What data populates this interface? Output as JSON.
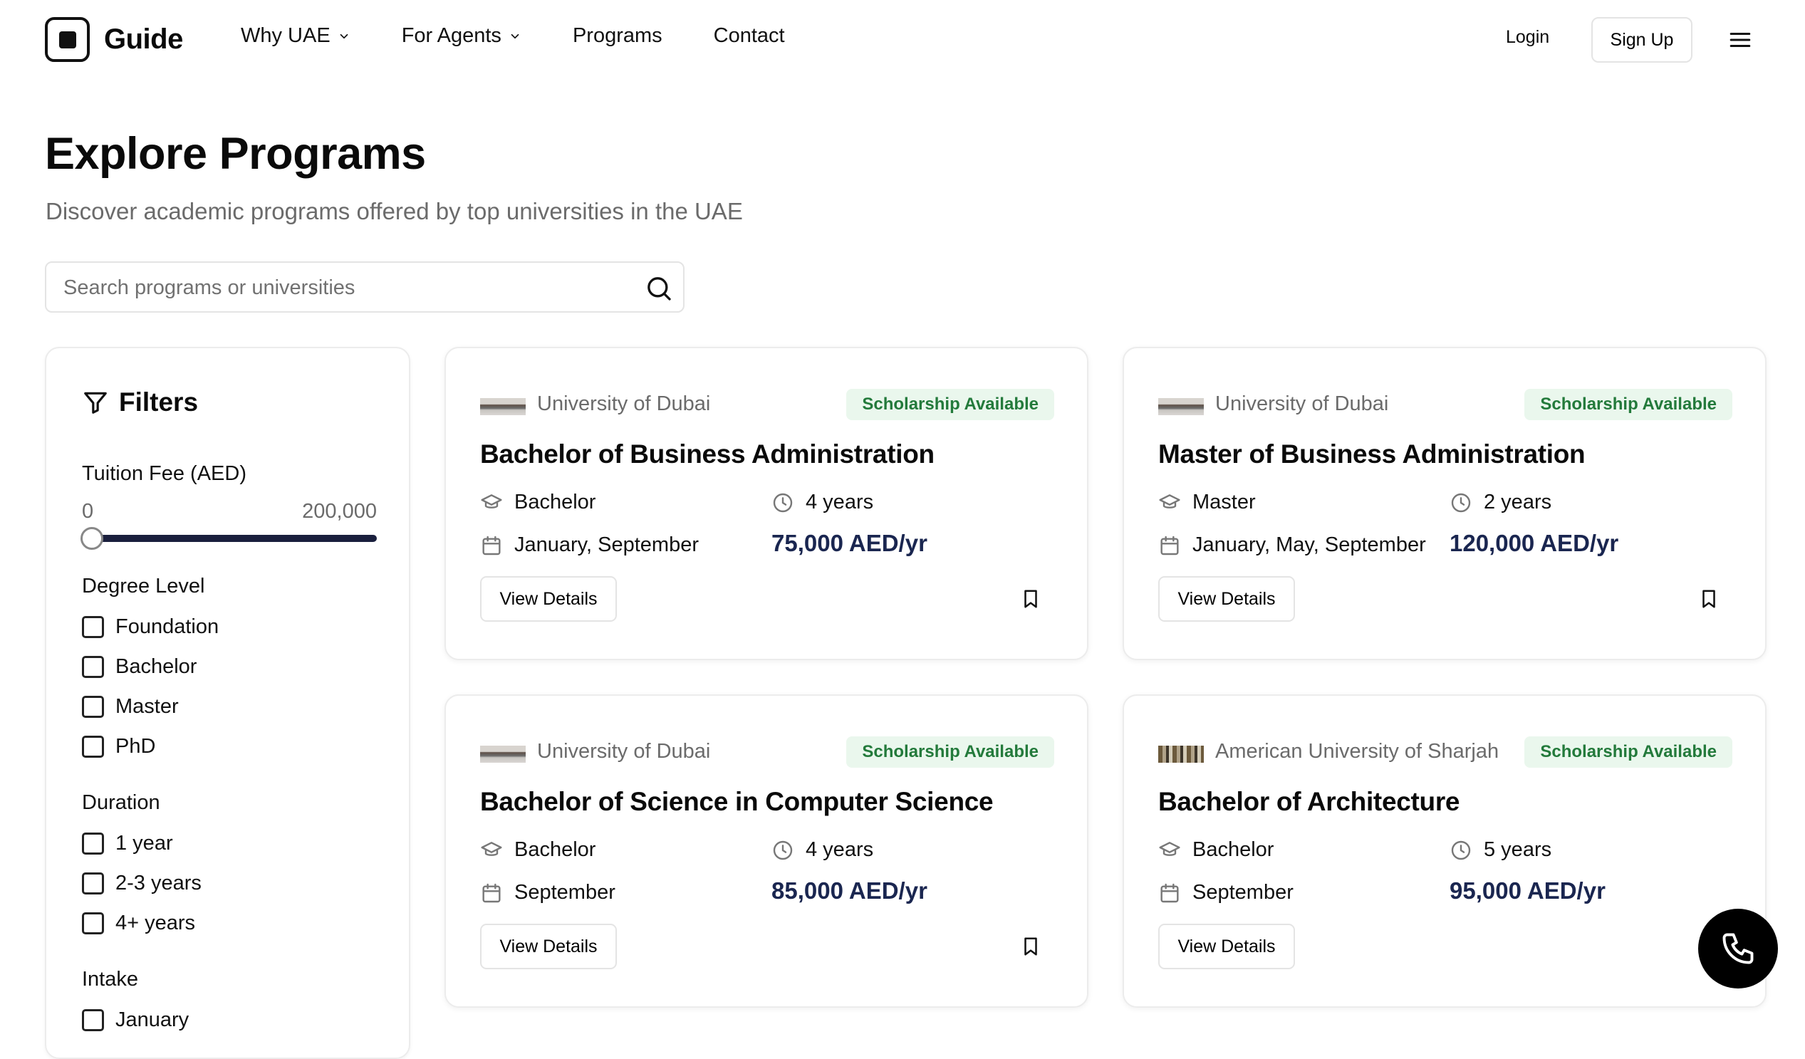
{
  "nav": {
    "brand": "Guide",
    "links": [
      {
        "label": "Why UAE",
        "dropdown": true
      },
      {
        "label": "For Agents",
        "dropdown": true
      },
      {
        "label": "Programs",
        "dropdown": false
      },
      {
        "label": "Contact",
        "dropdown": false
      }
    ],
    "login": "Login",
    "signup": "Sign Up"
  },
  "page": {
    "title": "Explore Programs",
    "subtitle": "Discover academic programs offered by top universities in the UAE"
  },
  "search": {
    "placeholder": "Search programs or universities",
    "value": ""
  },
  "filters": {
    "title": "Filters",
    "tuition": {
      "label": "Tuition Fee (AED)",
      "min": "0",
      "max": "200,000",
      "slider_value": 0
    },
    "degree": {
      "label": "Degree Level",
      "options": [
        "Foundation",
        "Bachelor",
        "Master",
        "PhD"
      ]
    },
    "duration": {
      "label": "Duration",
      "options": [
        "1 year",
        "2-3 years",
        "4+ years"
      ]
    },
    "intake": {
      "label": "Intake",
      "options": [
        "January"
      ]
    }
  },
  "programs": [
    {
      "university": "University of Dubai",
      "badge": "Scholarship Available",
      "title": "Bachelor of Business Administration",
      "degree": "Bachelor",
      "duration": "4 years",
      "intake": "January, September",
      "fee": "75,000 AED/yr",
      "cta": "View Details"
    },
    {
      "university": "University of Dubai",
      "badge": "Scholarship Available",
      "title": "Master of Business Administration",
      "degree": "Master",
      "duration": "2 years",
      "intake": "January, May, September",
      "fee": "120,000 AED/yr",
      "cta": "View Details"
    },
    {
      "university": "University of Dubai",
      "badge": "Scholarship Available",
      "title": "Bachelor of Science in Computer Science",
      "degree": "Bachelor",
      "duration": "4 years",
      "intake": "September",
      "fee": "85,000 AED/yr",
      "cta": "View Details"
    },
    {
      "university": "American University of Sharjah",
      "badge": "Scholarship Available",
      "title": "Bachelor of Architecture",
      "degree": "Bachelor",
      "duration": "5 years",
      "intake": "September",
      "fee": "95,000 AED/yr",
      "cta": "View Details"
    }
  ],
  "icons": {
    "logo": "square-logo-icon",
    "filter": "filter-icon",
    "degree": "graduation-cap-icon",
    "duration": "clock-icon",
    "intake": "calendar-icon",
    "bookmark": "bookmark-icon",
    "search": "search-icon",
    "menu": "hamburger-menu-icon",
    "call": "phone-icon"
  },
  "colors": {
    "badge_bg": "#eaf7ed",
    "badge_text": "#237a3b",
    "price": "#1a2650",
    "slider_track": "#1a1f3d"
  }
}
